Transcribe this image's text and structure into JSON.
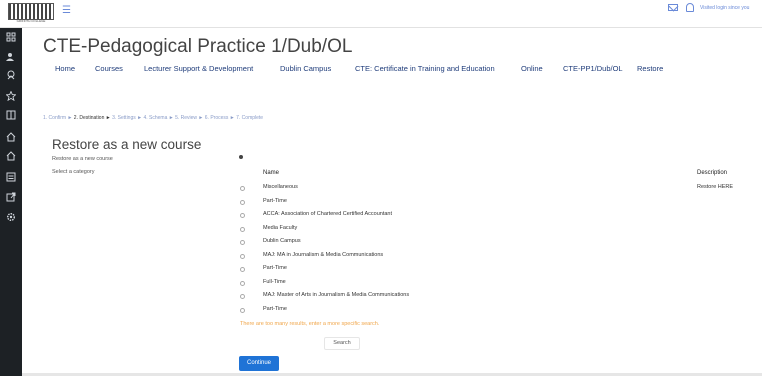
{
  "header": {
    "logo_text": "GRIFFITH COLLEGE",
    "menu_icon": "hamburger-icon",
    "mail_icon": "mail-icon",
    "bell_icon": "bell-icon",
    "login_status": "Visited login since you"
  },
  "sidebar": {
    "icons": [
      "grid-icon",
      "users-icon",
      "badge-icon",
      "star-icon",
      "book-icon",
      "home-icon",
      "home-icon",
      "list-icon",
      "export-icon",
      "settings-icon"
    ]
  },
  "course": {
    "title": "CTE-Pedagogical Practice 1/Dub/OL"
  },
  "nav": {
    "items": [
      "Home",
      "Courses",
      "Lecturer Support & Development",
      "Dublin Campus",
      "CTE: Certificate in Training and Education",
      "Online",
      "CTE-PP1/Dub/OL",
      "Restore"
    ]
  },
  "steps": {
    "done": "1. Confirm ►",
    "current": " 2. Destination ► ",
    "rest": "3. Settings ► 4. Schema ► 5. Review ► 6. Process ► 7. Complete"
  },
  "restore": {
    "title": "Restore as a new course",
    "option_label": "Restore as a new course",
    "category_label": "Select a category",
    "col_name": "Name",
    "col_description": "Description",
    "rows": [
      {
        "name": "Miscellaneous",
        "description": "Restore HERE"
      },
      {
        "name": "Part-Time",
        "description": ""
      },
      {
        "name": "ACCA: Association of Chartered Certified Accountant",
        "description": ""
      },
      {
        "name": "Media Faculty",
        "description": ""
      },
      {
        "name": "Dublin Campus",
        "description": ""
      },
      {
        "name": "MAJ: MA in Journalism & Media Communications",
        "description": ""
      },
      {
        "name": "Part-Time",
        "description": ""
      },
      {
        "name": "Full-Time",
        "description": ""
      },
      {
        "name": "MAJ: Master of Arts in Journalism & Media Communications",
        "description": ""
      },
      {
        "name": "Part-Time",
        "description": ""
      }
    ],
    "warning": "There are too many results, enter a more specific search.",
    "search_label": "Search",
    "continue_label": "Continue"
  }
}
